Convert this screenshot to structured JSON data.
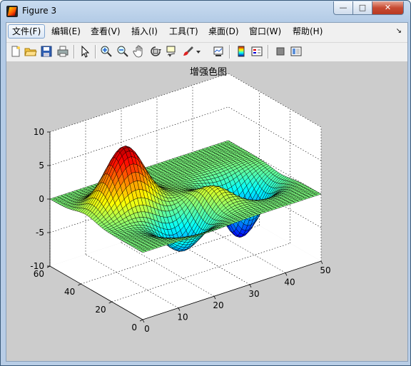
{
  "window": {
    "title": "Figure 3"
  },
  "window_controls": {
    "minimize": "—",
    "maximize": "□",
    "close": "✕"
  },
  "menubar": {
    "items": [
      {
        "label": "文件(F)",
        "active": true
      },
      {
        "label": "编辑(E)"
      },
      {
        "label": "查看(V)"
      },
      {
        "label": "插入(I)"
      },
      {
        "label": "工具(T)"
      },
      {
        "label": "桌面(D)"
      },
      {
        "label": "窗口(W)"
      },
      {
        "label": "帮助(H)"
      }
    ],
    "overflow_arrow": "↘"
  },
  "toolbar": {
    "buttons": [
      "new-figure-icon",
      "open-file-icon",
      "save-icon",
      "print-icon",
      "select-arrow-icon",
      "zoom-in-icon",
      "zoom-out-icon",
      "pan-hand-icon",
      "rotate-3d-icon",
      "data-cursor-icon",
      "brush-icon",
      "link-plot-icon",
      "colorbar-icon",
      "legend-icon",
      "hide-plot-tools-icon",
      "show-plot-tools-icon"
    ]
  },
  "chart_data": {
    "type": "surface",
    "title": "增强色图",
    "colormap": "jet",
    "x_ticks": [
      "0",
      "10",
      "20",
      "30",
      "40",
      "50"
    ],
    "y_ticks": [
      "0",
      "20",
      "40",
      "60"
    ],
    "z_ticks": [
      "10",
      "5",
      "0",
      "-5",
      "-10"
    ],
    "xlim": [
      0,
      50
    ],
    "ylim": [
      0,
      60
    ],
    "zlim": [
      -10,
      10
    ],
    "grid": true,
    "peaks": [
      {
        "x": 11,
        "y": 37,
        "z": 9
      },
      {
        "x": 31,
        "y": 22,
        "z": 4
      },
      {
        "x": 38,
        "y": 26,
        "z": -9
      },
      {
        "x": 18,
        "y": 16,
        "z": -5
      }
    ]
  }
}
